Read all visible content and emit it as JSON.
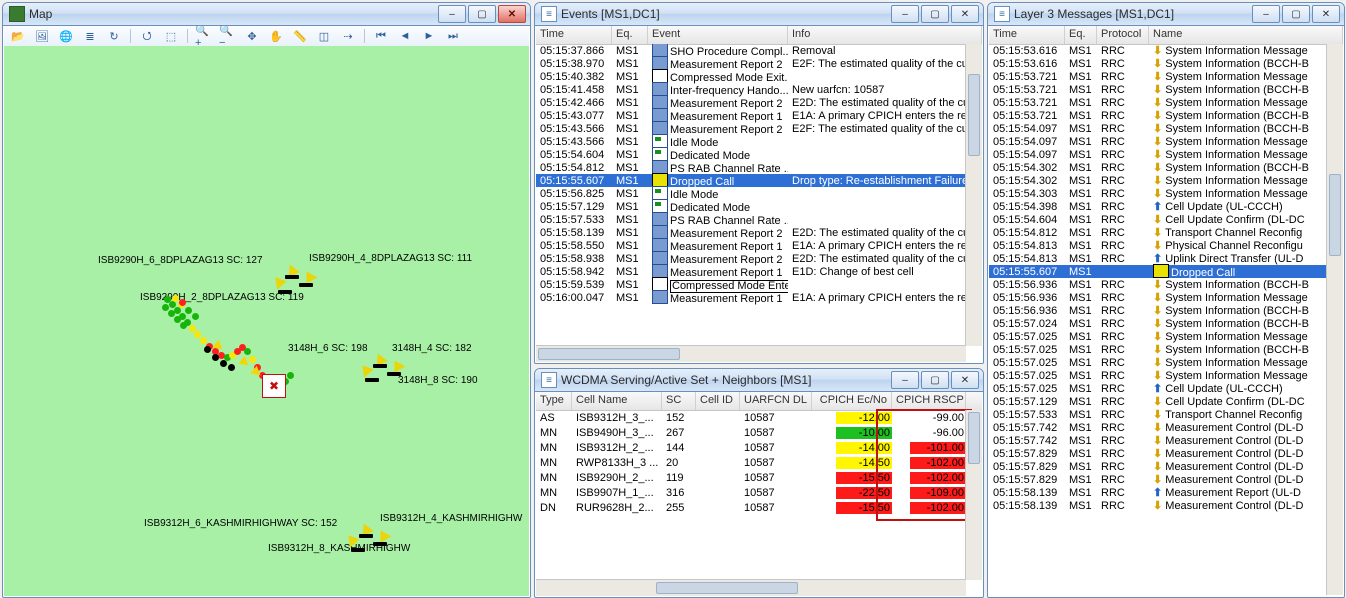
{
  "map": {
    "title": "Map",
    "labels": {
      "l1": "ISB9290H_6_8DPLAZAG13 SC: 127",
      "l2": "ISB9290H_4_8DPLAZAG13 SC: 111",
      "l3": "ISB9290H_2_8DPLAZAG13 SC: 119",
      "l4": "3148H_6 SC: 198",
      "l5": "3148H_4 SC: 182",
      "l6": "3148H_8 SC: 190",
      "l7": "ISB9312H_6_KASHMIRHIGHWAY SC: 152",
      "l8": "ISB9312H_4_KASHMIRHIGHW",
      "l9": "ISB9312H_8_KASHMIRHIGHW"
    }
  },
  "events": {
    "title": "Events  [MS1,DC1]",
    "cols": {
      "time": "Time",
      "eq": "Eq.",
      "event": "Event",
      "info": "Info"
    },
    "rows": [
      {
        "t": "05:15:37.866",
        "eq": "MS1",
        "ico": "report",
        "ev": "SHO Procedure Compl...",
        "info": "Removal"
      },
      {
        "t": "05:15:38.970",
        "eq": "MS1",
        "ico": "report",
        "ev": "Measurement Report 2",
        "info": "E2F: The estimated quality of the cu"
      },
      {
        "t": "05:15:40.382",
        "eq": "MS1",
        "ico": "cm",
        "ev": "Compressed Mode Exit...",
        "info": ""
      },
      {
        "t": "05:15:41.458",
        "eq": "MS1",
        "ico": "report",
        "ev": "Inter-frequency Hando...",
        "info": "New uarfcn: 10587"
      },
      {
        "t": "05:15:42.466",
        "eq": "MS1",
        "ico": "report",
        "ev": "Measurement Report 2",
        "info": "E2D: The estimated quality of the cu"
      },
      {
        "t": "05:15:43.077",
        "eq": "MS1",
        "ico": "report",
        "ev": "Measurement Report 1",
        "info": "E1A: A primary CPICH enters the rep"
      },
      {
        "t": "05:15:43.566",
        "eq": "MS1",
        "ico": "report",
        "ev": "Measurement Report 2",
        "info": "E2F: The estimated quality of the cu"
      },
      {
        "t": "05:15:43.566",
        "eq": "MS1",
        "ico": "mode",
        "ev": "Idle Mode",
        "info": ""
      },
      {
        "t": "05:15:54.604",
        "eq": "MS1",
        "ico": "mode",
        "ev": "Dedicated Mode",
        "info": ""
      },
      {
        "t": "05:15:54.812",
        "eq": "MS1",
        "ico": "report",
        "ev": "PS RAB Channel Rate ...",
        "info": ""
      },
      {
        "t": "05:15:55.607",
        "eq": "MS1",
        "ico": "call",
        "ev": "Dropped Call",
        "info": "Drop type: Re-establishment Failure",
        "sel": true
      },
      {
        "t": "05:15:56.825",
        "eq": "MS1",
        "ico": "mode",
        "ev": "Idle Mode",
        "info": ""
      },
      {
        "t": "05:15:57.129",
        "eq": "MS1",
        "ico": "mode",
        "ev": "Dedicated Mode",
        "info": ""
      },
      {
        "t": "05:15:57.533",
        "eq": "MS1",
        "ico": "report",
        "ev": "PS RAB Channel Rate ...",
        "info": ""
      },
      {
        "t": "05:15:58.139",
        "eq": "MS1",
        "ico": "report",
        "ev": "Measurement Report 2",
        "info": "E2D: The estimated quality of the cu"
      },
      {
        "t": "05:15:58.550",
        "eq": "MS1",
        "ico": "report",
        "ev": "Measurement Report 1",
        "info": "E1A: A primary CPICH enters the rep"
      },
      {
        "t": "05:15:58.938",
        "eq": "MS1",
        "ico": "report",
        "ev": "Measurement Report 2",
        "info": "E2D: The estimated quality of the cu"
      },
      {
        "t": "05:15:58.942",
        "eq": "MS1",
        "ico": "report",
        "ev": "Measurement Report 1",
        "info": "E1D: Change of best cell"
      },
      {
        "t": "05:15:59.539",
        "eq": "MS1",
        "ico": "cm",
        "ev": "Compressed Mode Entered",
        "info": "",
        "boxed": true
      },
      {
        "t": "05:16:00.047",
        "eq": "MS1",
        "ico": "report",
        "ev": "Measurement Report 1",
        "info": "E1A: A primary CPICH enters the rep"
      }
    ]
  },
  "l3": {
    "title": "Layer 3 Messages  [MS1,DC1]",
    "cols": {
      "time": "Time",
      "eq": "Eq.",
      "proto": "Protocol",
      "name": "Name"
    },
    "rows": [
      {
        "t": "05:15:53.616",
        "eq": "MS1",
        "p": "RRC",
        "dir": "dn",
        "n": "System Information Message"
      },
      {
        "t": "05:15:53.616",
        "eq": "MS1",
        "p": "RRC",
        "dir": "dn",
        "n": "System Information (BCCH-B"
      },
      {
        "t": "05:15:53.721",
        "eq": "MS1",
        "p": "RRC",
        "dir": "dn",
        "n": "System Information Message"
      },
      {
        "t": "05:15:53.721",
        "eq": "MS1",
        "p": "RRC",
        "dir": "dn",
        "n": "System Information (BCCH-B"
      },
      {
        "t": "05:15:53.721",
        "eq": "MS1",
        "p": "RRC",
        "dir": "dn",
        "n": "System Information Message"
      },
      {
        "t": "05:15:53.721",
        "eq": "MS1",
        "p": "RRC",
        "dir": "dn",
        "n": "System Information (BCCH-B"
      },
      {
        "t": "05:15:54.097",
        "eq": "MS1",
        "p": "RRC",
        "dir": "dn",
        "n": "System Information (BCCH-B"
      },
      {
        "t": "05:15:54.097",
        "eq": "MS1",
        "p": "RRC",
        "dir": "dn",
        "n": "System Information Message"
      },
      {
        "t": "05:15:54.097",
        "eq": "MS1",
        "p": "RRC",
        "dir": "dn",
        "n": "System Information Message"
      },
      {
        "t": "05:15:54.302",
        "eq": "MS1",
        "p": "RRC",
        "dir": "dn",
        "n": "System Information (BCCH-B"
      },
      {
        "t": "05:15:54.302",
        "eq": "MS1",
        "p": "RRC",
        "dir": "dn",
        "n": "System Information Message"
      },
      {
        "t": "05:15:54.303",
        "eq": "MS1",
        "p": "RRC",
        "dir": "dn",
        "n": "System Information Message"
      },
      {
        "t": "05:15:54.398",
        "eq": "MS1",
        "p": "RRC",
        "dir": "up",
        "n": "Cell Update (UL-CCCH)"
      },
      {
        "t": "05:15:54.604",
        "eq": "MS1",
        "p": "RRC",
        "dir": "dn",
        "n": "Cell Update Confirm (DL-DC"
      },
      {
        "t": "05:15:54.812",
        "eq": "MS1",
        "p": "RRC",
        "dir": "dn",
        "n": "Transport Channel Reconfig"
      },
      {
        "t": "05:15:54.813",
        "eq": "MS1",
        "p": "RRC",
        "dir": "dn",
        "n": "Physical Channel Reconfigu"
      },
      {
        "t": "05:15:54.813",
        "eq": "MS1",
        "p": "RRC",
        "dir": "up",
        "n": "Uplink Direct Transfer (UL-D"
      },
      {
        "t": "05:15:55.607",
        "eq": "MS1",
        "p": "",
        "dir": "call",
        "n": "Dropped Call",
        "sel": true
      },
      {
        "t": "05:15:56.936",
        "eq": "MS1",
        "p": "RRC",
        "dir": "dn",
        "n": "System Information (BCCH-B"
      },
      {
        "t": "05:15:56.936",
        "eq": "MS1",
        "p": "RRC",
        "dir": "dn",
        "n": "System Information Message"
      },
      {
        "t": "05:15:56.936",
        "eq": "MS1",
        "p": "RRC",
        "dir": "dn",
        "n": "System Information (BCCH-B"
      },
      {
        "t": "05:15:57.024",
        "eq": "MS1",
        "p": "RRC",
        "dir": "dn",
        "n": "System Information (BCCH-B"
      },
      {
        "t": "05:15:57.025",
        "eq": "MS1",
        "p": "RRC",
        "dir": "dn",
        "n": "System Information Message"
      },
      {
        "t": "05:15:57.025",
        "eq": "MS1",
        "p": "RRC",
        "dir": "dn",
        "n": "System Information (BCCH-B"
      },
      {
        "t": "05:15:57.025",
        "eq": "MS1",
        "p": "RRC",
        "dir": "dn",
        "n": "System Information Message"
      },
      {
        "t": "05:15:57.025",
        "eq": "MS1",
        "p": "RRC",
        "dir": "dn",
        "n": "System Information Message"
      },
      {
        "t": "05:15:57.025",
        "eq": "MS1",
        "p": "RRC",
        "dir": "up",
        "n": "Cell Update (UL-CCCH)"
      },
      {
        "t": "05:15:57.129",
        "eq": "MS1",
        "p": "RRC",
        "dir": "dn",
        "n": "Cell Update Confirm (DL-DC"
      },
      {
        "t": "05:15:57.533",
        "eq": "MS1",
        "p": "RRC",
        "dir": "dn",
        "n": "Transport Channel Reconfig"
      },
      {
        "t": "05:15:57.742",
        "eq": "MS1",
        "p": "RRC",
        "dir": "dn",
        "n": "Measurement Control (DL-D"
      },
      {
        "t": "05:15:57.742",
        "eq": "MS1",
        "p": "RRC",
        "dir": "dn",
        "n": "Measurement Control (DL-D"
      },
      {
        "t": "05:15:57.829",
        "eq": "MS1",
        "p": "RRC",
        "dir": "dn",
        "n": "Measurement Control (DL-D"
      },
      {
        "t": "05:15:57.829",
        "eq": "MS1",
        "p": "RRC",
        "dir": "dn",
        "n": "Measurement Control (DL-D"
      },
      {
        "t": "05:15:57.829",
        "eq": "MS1",
        "p": "RRC",
        "dir": "dn",
        "n": "Measurement Control (DL-D"
      },
      {
        "t": "05:15:58.139",
        "eq": "MS1",
        "p": "RRC",
        "dir": "up",
        "n": "Measurement Report (UL-D"
      },
      {
        "t": "05:15:58.139",
        "eq": "MS1",
        "p": "RRC",
        "dir": "dn",
        "n": "Measurement Control (DL-D"
      }
    ]
  },
  "wcd": {
    "title": "WCDMA Serving/Active Set + Neighbors  [MS1]",
    "cols": {
      "type": "Type",
      "name": "Cell Name",
      "sc": "SC",
      "cid": "Cell ID",
      "uarfcn": "UARFCN DL",
      "ecno": "CPICH Ec/No",
      "rscp": "CPICH RSCP"
    },
    "rows": [
      {
        "type": "AS",
        "name": "ISB9312H_3_...",
        "sc": "152",
        "cid": "",
        "uarfcn": "10587",
        "ecno": "-12.00",
        "ecnoCls": "bgY",
        "rscp": "-99.00",
        "rscpCls": ""
      },
      {
        "type": "MN",
        "name": "ISB9490H_3_...",
        "sc": "267",
        "cid": "",
        "uarfcn": "10587",
        "ecno": "-10.00",
        "ecnoCls": "bgG",
        "rscp": "-96.00",
        "rscpCls": ""
      },
      {
        "type": "MN",
        "name": "ISB9312H_2_...",
        "sc": "144",
        "cid": "",
        "uarfcn": "10587",
        "ecno": "-14.00",
        "ecnoCls": "bgY",
        "rscp": "-101.00",
        "rscpCls": "bgR"
      },
      {
        "type": "MN",
        "name": "RWP8133H_3 ...",
        "sc": "20",
        "cid": "",
        "uarfcn": "10587",
        "ecno": "-14.50",
        "ecnoCls": "bgY",
        "rscp": "-102.00",
        "rscpCls": "bgR"
      },
      {
        "type": "MN",
        "name": "ISB9290H_2_...",
        "sc": "119",
        "cid": "",
        "uarfcn": "10587",
        "ecno": "-15.50",
        "ecnoCls": "bgR",
        "rscp": "-102.00",
        "rscpCls": "bgR"
      },
      {
        "type": "MN",
        "name": "ISB9907H_1_...",
        "sc": "316",
        "cid": "",
        "uarfcn": "10587",
        "ecno": "-22.50",
        "ecnoCls": "bgR",
        "rscp": "-109.00",
        "rscpCls": "bgR"
      },
      {
        "type": "DN",
        "name": "RUR9628H_2...",
        "sc": "255",
        "cid": "",
        "uarfcn": "10587",
        "ecno": "-15.50",
        "ecnoCls": "bgR",
        "rscp": "-102.00",
        "rscpCls": "bgR"
      }
    ]
  },
  "winbtns": {
    "min": "–",
    "max": "▢",
    "close": "✕",
    "icon": "≡"
  }
}
